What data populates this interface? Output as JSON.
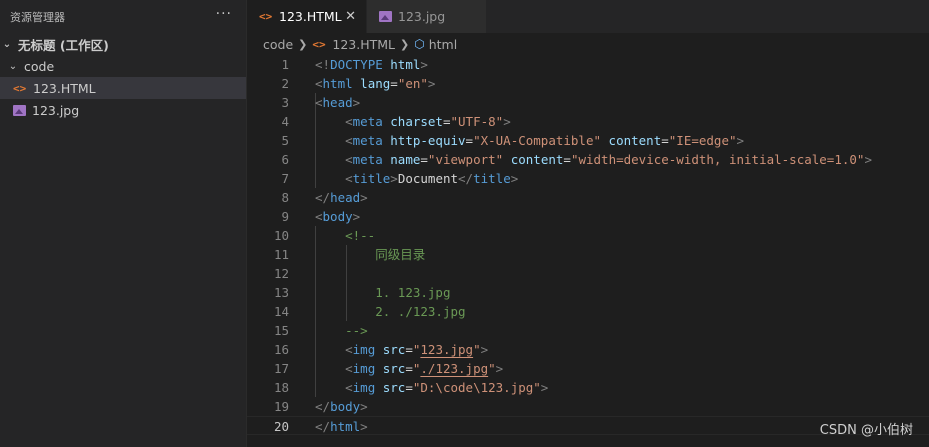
{
  "sidebar": {
    "title": "资源管理器",
    "more": "···",
    "workspace": "无标题 (工作区)",
    "folder": "code",
    "files": [
      {
        "name": "123.HTML",
        "icon": "html-file-icon"
      },
      {
        "name": "123.jpg",
        "icon": "image-file-icon"
      }
    ]
  },
  "tabs": [
    {
      "label": "123.HTML",
      "close": "✕",
      "active": true
    },
    {
      "label": "123.jpg",
      "active": false
    }
  ],
  "breadcrumb": {
    "folder": "code",
    "file": "123.HTML",
    "symbol": "html"
  },
  "editor": {
    "current_line": 20,
    "lines": [
      {
        "n": "1",
        "tokens": [
          [
            "t-punct",
            "<!"
          ],
          [
            "t-tag",
            "DOCTYPE"
          ],
          [
            "t-text",
            " "
          ],
          [
            "t-attr",
            "html"
          ],
          [
            "t-punct",
            ">"
          ]
        ]
      },
      {
        "n": "2",
        "tokens": [
          [
            "t-punct",
            "<"
          ],
          [
            "t-tag",
            "html"
          ],
          [
            "t-text",
            " "
          ],
          [
            "t-attr",
            "lang"
          ],
          [
            "t-text",
            "="
          ],
          [
            "t-str",
            "\"en\""
          ],
          [
            "t-punct",
            ">"
          ]
        ]
      },
      {
        "n": "3",
        "tokens": [
          [
            "t-punct",
            "<"
          ],
          [
            "t-tag",
            "head"
          ],
          [
            "t-punct",
            ">"
          ]
        ]
      },
      {
        "n": "4",
        "tokens": [
          [
            "t-text",
            "    "
          ],
          [
            "t-punct",
            "<"
          ],
          [
            "t-tag",
            "meta"
          ],
          [
            "t-text",
            " "
          ],
          [
            "t-attr",
            "charset"
          ],
          [
            "t-text",
            "="
          ],
          [
            "t-str",
            "\"UTF-8\""
          ],
          [
            "t-punct",
            ">"
          ]
        ]
      },
      {
        "n": "5",
        "tokens": [
          [
            "t-text",
            "    "
          ],
          [
            "t-punct",
            "<"
          ],
          [
            "t-tag",
            "meta"
          ],
          [
            "t-text",
            " "
          ],
          [
            "t-attr",
            "http-equiv"
          ],
          [
            "t-text",
            "="
          ],
          [
            "t-str",
            "\"X-UA-Compatible\""
          ],
          [
            "t-text",
            " "
          ],
          [
            "t-attr",
            "content"
          ],
          [
            "t-text",
            "="
          ],
          [
            "t-str",
            "\"IE=edge\""
          ],
          [
            "t-punct",
            ">"
          ]
        ]
      },
      {
        "n": "6",
        "tokens": [
          [
            "t-text",
            "    "
          ],
          [
            "t-punct",
            "<"
          ],
          [
            "t-tag",
            "meta"
          ],
          [
            "t-text",
            " "
          ],
          [
            "t-attr",
            "name"
          ],
          [
            "t-text",
            "="
          ],
          [
            "t-str",
            "\"viewport\""
          ],
          [
            "t-text",
            " "
          ],
          [
            "t-attr",
            "content"
          ],
          [
            "t-text",
            "="
          ],
          [
            "t-str",
            "\"width=device-width, initial-scale=1.0\""
          ],
          [
            "t-punct",
            ">"
          ]
        ]
      },
      {
        "n": "7",
        "tokens": [
          [
            "t-text",
            "    "
          ],
          [
            "t-punct",
            "<"
          ],
          [
            "t-tag",
            "title"
          ],
          [
            "t-punct",
            ">"
          ],
          [
            "t-text",
            "Document"
          ],
          [
            "t-punct",
            "</"
          ],
          [
            "t-tag",
            "title"
          ],
          [
            "t-punct",
            ">"
          ]
        ]
      },
      {
        "n": "8",
        "tokens": [
          [
            "t-punct",
            "</"
          ],
          [
            "t-tag",
            "head"
          ],
          [
            "t-punct",
            ">"
          ]
        ]
      },
      {
        "n": "9",
        "tokens": [
          [
            "t-punct",
            "<"
          ],
          [
            "t-tag",
            "body"
          ],
          [
            "t-punct",
            ">"
          ]
        ]
      },
      {
        "n": "10",
        "tokens": [
          [
            "t-text",
            "    "
          ],
          [
            "t-cmt",
            "<!--"
          ]
        ]
      },
      {
        "n": "11",
        "tokens": [
          [
            "t-text",
            "        "
          ],
          [
            "t-cmt",
            "同级目录"
          ]
        ]
      },
      {
        "n": "12",
        "tokens": []
      },
      {
        "n": "13",
        "tokens": [
          [
            "t-text",
            "        "
          ],
          [
            "t-cmt",
            "1. 123.jpg"
          ]
        ]
      },
      {
        "n": "14",
        "tokens": [
          [
            "t-text",
            "        "
          ],
          [
            "t-cmt",
            "2. ./123.jpg"
          ]
        ]
      },
      {
        "n": "15",
        "tokens": [
          [
            "t-text",
            "    "
          ],
          [
            "t-cmt",
            "-->"
          ]
        ]
      },
      {
        "n": "16",
        "tokens": [
          [
            "t-text",
            "    "
          ],
          [
            "t-punct",
            "<"
          ],
          [
            "t-tag",
            "img"
          ],
          [
            "t-text",
            " "
          ],
          [
            "t-attr",
            "src"
          ],
          [
            "t-text",
            "="
          ],
          [
            "t-str",
            "\""
          ],
          [
            "t-str ul",
            "123.jpg"
          ],
          [
            "t-str",
            "\""
          ],
          [
            "t-punct",
            ">"
          ]
        ]
      },
      {
        "n": "17",
        "tokens": [
          [
            "t-text",
            "    "
          ],
          [
            "t-punct",
            "<"
          ],
          [
            "t-tag",
            "img"
          ],
          [
            "t-text",
            " "
          ],
          [
            "t-attr",
            "src"
          ],
          [
            "t-text",
            "="
          ],
          [
            "t-str",
            "\""
          ],
          [
            "t-str ul",
            "./123.jpg"
          ],
          [
            "t-str",
            "\""
          ],
          [
            "t-punct",
            ">"
          ]
        ]
      },
      {
        "n": "18",
        "tokens": [
          [
            "t-text",
            "    "
          ],
          [
            "t-punct",
            "<"
          ],
          [
            "t-tag",
            "img"
          ],
          [
            "t-text",
            " "
          ],
          [
            "t-attr",
            "src"
          ],
          [
            "t-text",
            "="
          ],
          [
            "t-str",
            "\"D:\\code\\123.jpg\""
          ],
          [
            "t-punct",
            ">"
          ]
        ]
      },
      {
        "n": "19",
        "tokens": [
          [
            "t-punct",
            "</"
          ],
          [
            "t-tag",
            "body"
          ],
          [
            "t-punct",
            ">"
          ]
        ]
      },
      {
        "n": "20",
        "tokens": [
          [
            "t-punct",
            "</"
          ],
          [
            "t-tag",
            "html"
          ],
          [
            "t-punct",
            ">"
          ]
        ]
      }
    ]
  },
  "watermark": "CSDN @小伯树"
}
